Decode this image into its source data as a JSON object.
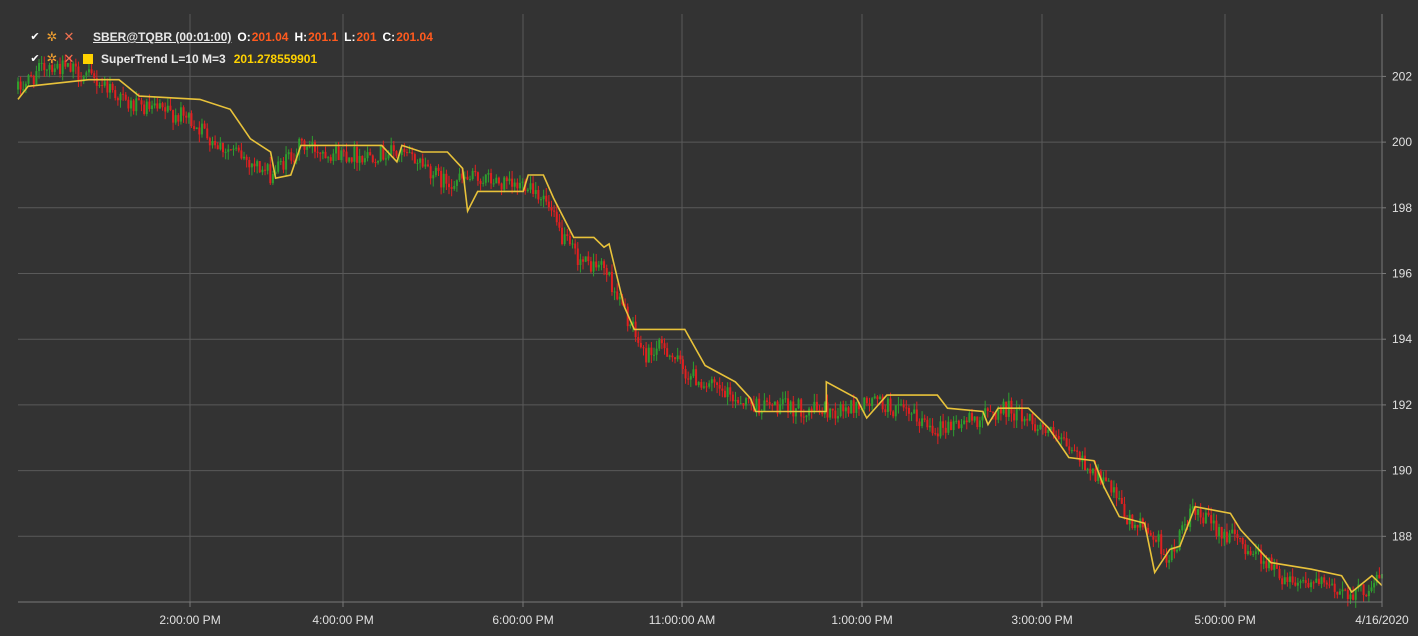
{
  "legend": {
    "series_label": "SBER@TQBR (00:01:00)",
    "ohlc": [
      {
        "key": "O:",
        "value": "201.04"
      },
      {
        "key": "H:",
        "value": "201.1"
      },
      {
        "key": "L:",
        "value": "201"
      },
      {
        "key": "C:",
        "value": "201.04"
      }
    ],
    "indicator_label": "SuperTrend L=10 M=3",
    "indicator_value": "201.278559901",
    "icons": [
      "check-icon",
      "gear-icon",
      "close-icon",
      "color-swatch"
    ]
  },
  "colors": {
    "background": "#333333",
    "grid": "#5a5a5a",
    "axis_text": "#e0e0e0",
    "candle_up": "#2e9e2e",
    "candle_down": "#e02020",
    "supertrend": "#e8c23a",
    "legend_value": "#ff5a1e",
    "indicator_value": "#ffd200"
  },
  "chart_data": {
    "type": "candlestick",
    "instrument": "SBER@TQBR",
    "timeframe": "00:01:00",
    "x_tick_labels": [
      "2:00:00 PM",
      "4:00:00 PM",
      "6:00:00 PM",
      "11:00:00 AM",
      "1:00:00 PM",
      "3:00:00 PM",
      "5:00:00 PM",
      "4/16/2020"
    ],
    "y_tick_labels": [
      "188",
      "190",
      "192",
      "194",
      "196",
      "198",
      "200",
      "202"
    ],
    "y_ticks": [
      188,
      190,
      192,
      194,
      196,
      198,
      200,
      202
    ],
    "ylim": [
      186.0,
      203.9
    ],
    "grid": true,
    "approx_close_path": [
      [
        0.0,
        201.6
      ],
      [
        0.03,
        202.4
      ],
      [
        0.06,
        202.1
      ],
      [
        0.09,
        201.7
      ],
      [
        0.11,
        201.1
      ],
      [
        0.15,
        200.9
      ],
      [
        0.17,
        200.7
      ],
      [
        0.2,
        199.9
      ],
      [
        0.22,
        199.6
      ],
      [
        0.25,
        199.0
      ],
      [
        0.28,
        199.9
      ],
      [
        0.31,
        199.7
      ],
      [
        0.34,
        199.6
      ],
      [
        0.37,
        199.7
      ],
      [
        0.4,
        199.4
      ],
      [
        0.42,
        198.8
      ],
      [
        0.46,
        198.9
      ],
      [
        0.49,
        198.6
      ],
      [
        0.505,
        198.8
      ],
      [
        0.52,
        198.3
      ],
      [
        0.54,
        197.0
      ],
      [
        0.56,
        196.3
      ],
      [
        0.58,
        196.2
      ],
      [
        0.595,
        195.2
      ],
      [
        0.62,
        193.5
      ],
      [
        0.64,
        193.8
      ],
      [
        0.66,
        193.0
      ],
      [
        0.7,
        192.3
      ],
      [
        0.73,
        192.0
      ],
      [
        0.77,
        191.9
      ],
      [
        0.81,
        191.8
      ],
      [
        0.85,
        192.1
      ],
      [
        0.88,
        191.7
      ],
      [
        0.91,
        191.3
      ],
      [
        0.95,
        191.6
      ],
      [
        0.98,
        191.9
      ],
      [
        1.01,
        191.4
      ],
      [
        1.05,
        190.4
      ],
      [
        1.08,
        189.5
      ],
      [
        1.1,
        188.4
      ],
      [
        1.12,
        188.2
      ],
      [
        1.14,
        187.3
      ],
      [
        1.16,
        188.7
      ],
      [
        1.18,
        188.4
      ],
      [
        1.2,
        188.0
      ],
      [
        1.23,
        187.4
      ],
      [
        1.25,
        186.8
      ],
      [
        1.28,
        186.6
      ],
      [
        1.3,
        186.4
      ],
      [
        1.33,
        186.3
      ],
      [
        1.35,
        186.8
      ]
    ],
    "supertrend": {
      "name": "SuperTrend L=10 M=3",
      "length": 10,
      "multiplier": 3,
      "last_value": 201.278559901,
      "approx_path": [
        [
          0.0,
          201.3
        ],
        [
          0.01,
          201.7
        ],
        [
          0.07,
          201.9
        ],
        [
          0.09,
          201.9
        ],
        [
          0.1,
          201.9
        ],
        [
          0.12,
          201.4
        ],
        [
          0.18,
          201.3
        ],
        [
          0.21,
          201.0
        ],
        [
          0.23,
          200.1
        ],
        [
          0.25,
          199.7
        ],
        [
          0.255,
          198.9
        ],
        [
          0.27,
          199.0
        ],
        [
          0.28,
          199.9
        ],
        [
          0.32,
          199.9
        ],
        [
          0.36,
          199.9
        ],
        [
          0.375,
          199.4
        ],
        [
          0.38,
          199.9
        ],
        [
          0.4,
          199.7
        ],
        [
          0.425,
          199.7
        ],
        [
          0.44,
          199.2
        ],
        [
          0.445,
          197.9
        ],
        [
          0.455,
          198.5
        ],
        [
          0.5,
          198.5
        ],
        [
          0.505,
          199.0
        ],
        [
          0.52,
          199.0
        ],
        [
          0.53,
          198.3
        ],
        [
          0.55,
          197.1
        ],
        [
          0.57,
          197.1
        ],
        [
          0.58,
          196.8
        ],
        [
          0.585,
          196.9
        ],
        [
          0.6,
          195.0
        ],
        [
          0.61,
          194.3
        ],
        [
          0.66,
          194.3
        ],
        [
          0.68,
          193.2
        ],
        [
          0.71,
          192.7
        ],
        [
          0.725,
          192.2
        ],
        [
          0.73,
          191.8
        ],
        [
          0.8,
          191.8
        ],
        [
          0.8,
          192.7
        ],
        [
          0.83,
          192.2
        ],
        [
          0.84,
          191.6
        ],
        [
          0.86,
          192.3
        ],
        [
          0.91,
          192.3
        ],
        [
          0.92,
          191.9
        ],
        [
          0.955,
          191.8
        ],
        [
          0.96,
          191.4
        ],
        [
          0.97,
          191.9
        ],
        [
          1.0,
          191.9
        ],
        [
          1.02,
          191.3
        ],
        [
          1.04,
          190.4
        ],
        [
          1.065,
          190.3
        ],
        [
          1.075,
          189.5
        ],
        [
          1.09,
          188.6
        ],
        [
          1.115,
          188.4
        ],
        [
          1.125,
          186.9
        ],
        [
          1.14,
          187.6
        ],
        [
          1.15,
          187.7
        ],
        [
          1.165,
          188.9
        ],
        [
          1.2,
          188.7
        ],
        [
          1.21,
          188.2
        ],
        [
          1.24,
          187.2
        ],
        [
          1.28,
          187.0
        ],
        [
          1.31,
          186.8
        ],
        [
          1.32,
          186.3
        ],
        [
          1.34,
          186.8
        ],
        [
          1.35,
          186.5
        ]
      ]
    }
  }
}
